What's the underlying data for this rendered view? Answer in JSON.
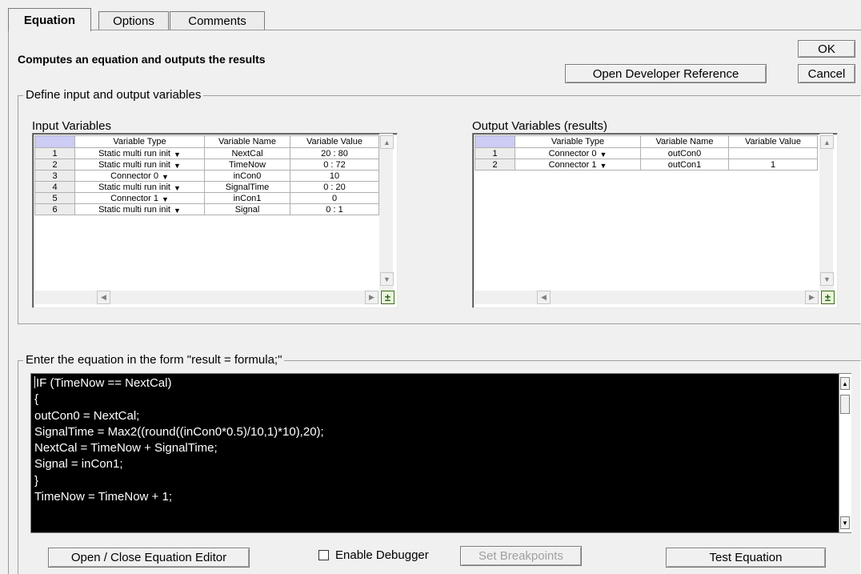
{
  "tabs": [
    {
      "label": "Equation",
      "active": true
    },
    {
      "label": "Options",
      "active": false
    },
    {
      "label": "Comments",
      "active": false
    }
  ],
  "subtitle": "Computes an equation and outputs the results",
  "buttons": {
    "ok": "OK",
    "cancel": "Cancel",
    "dev_ref": "Open Developer Reference",
    "open_close_editor": "Open / Close Equation Editor",
    "set_breakpoints": "Set Breakpoints",
    "test_equation": "Test Equation"
  },
  "define_group_label": "Define input and output variables",
  "input_vars": {
    "title": "Input Variables",
    "headers": [
      "Variable Type",
      "Variable Name",
      "Variable Value"
    ],
    "rows": [
      {
        "n": "1",
        "type": "Static multi run init",
        "name": "NextCal",
        "value": "20 : 80"
      },
      {
        "n": "2",
        "type": "Static multi run init",
        "name": "TimeNow",
        "value": "0 : 72"
      },
      {
        "n": "3",
        "type": "Connector 0",
        "name": "inCon0",
        "value": "10"
      },
      {
        "n": "4",
        "type": "Static multi run init",
        "name": "SignalTime",
        "value": "0 : 20"
      },
      {
        "n": "5",
        "type": "Connector 1",
        "name": "inCon1",
        "value": "0"
      },
      {
        "n": "6",
        "type": "Static multi run init",
        "name": "Signal",
        "value": "0 : 1"
      }
    ]
  },
  "output_vars": {
    "title": "Output Variables (results)",
    "headers": [
      "Variable Type",
      "Variable Name",
      "Variable Value"
    ],
    "rows": [
      {
        "n": "1",
        "type": "Connector 0",
        "name": "outCon0",
        "value": ""
      },
      {
        "n": "2",
        "type": "Connector 1",
        "name": "outCon1",
        "value": "1"
      }
    ]
  },
  "equation_group_label": "Enter the equation in the form \"result = formula;\"",
  "equation_lines": [
    "IF (TimeNow == NextCal)",
    "{",
    "outCon0 = NextCal;",
    "SignalTime = Max2((round((inCon0*0.5)/10,1)*10),20);",
    "NextCal = TimeNow + SignalTime;",
    "Signal = inCon1;",
    "}",
    "TimeNow = TimeNow + 1;"
  ],
  "debugger": {
    "label": "Enable Debugger",
    "checked": false
  },
  "icons": {
    "dropdown": "chevron-down-icon",
    "add_remove": "plus-minus-icon",
    "scroll_up": "arrow-up-icon",
    "scroll_down": "arrow-down-icon",
    "scroll_left": "arrow-left-icon",
    "scroll_right": "arrow-right-icon"
  },
  "colors": {
    "background": "#f0f0f0",
    "editor_bg": "#000000",
    "editor_text": "#ffffff",
    "grid_corner": "#ccccf4"
  }
}
